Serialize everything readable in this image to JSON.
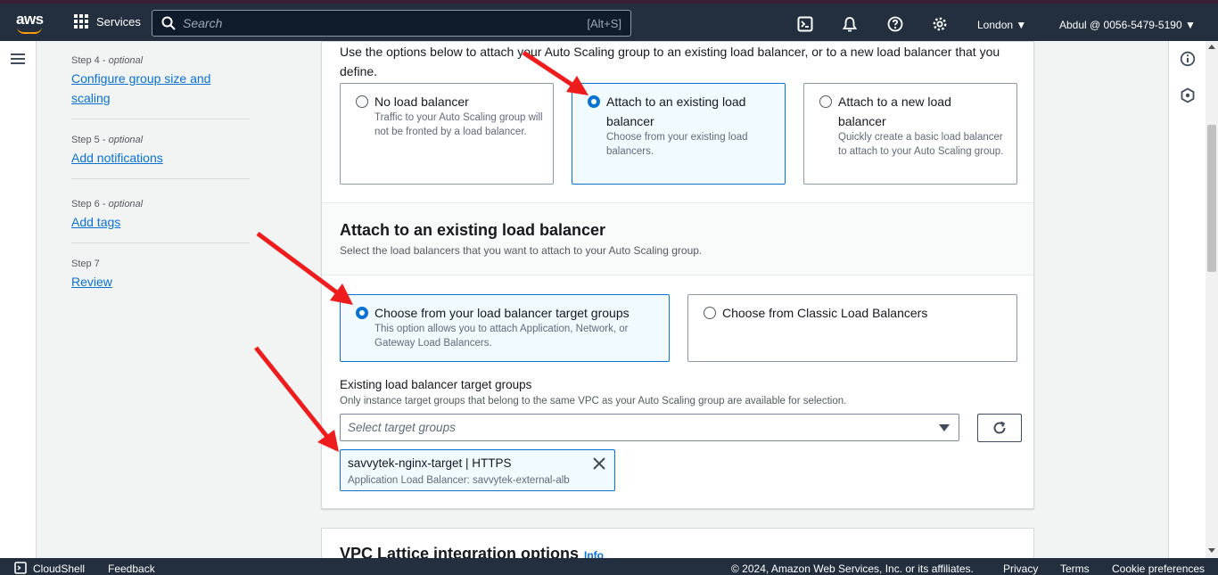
{
  "topbar": {
    "logo": "aws",
    "services_label": "Services",
    "search_placeholder": "Search",
    "search_shortcut": "[Alt+S]",
    "region": "London ▼",
    "account": "Abdul @ 0056-5479-5190 ▼",
    "icons": [
      "cloudshell-icon",
      "bell-icon",
      "help-icon",
      "gear-icon"
    ]
  },
  "steps": [
    {
      "label": "Step 4 - ",
      "optional": "optional",
      "link": "Configure group size and scaling"
    },
    {
      "label": "Step 5 - ",
      "optional": "optional",
      "link": "Add notifications"
    },
    {
      "label": "Step 6 - ",
      "optional": "optional",
      "link": "Add tags"
    },
    {
      "label": "Step 7",
      "optional": "",
      "link": "Review"
    }
  ],
  "load_balancing": {
    "intro": "Use the options below to attach your Auto Scaling group to an existing load balancer, or to a new load balancer that you define.",
    "options": [
      {
        "title": "No load balancer",
        "desc": "Traffic to your Auto Scaling group will not be fronted by a load balancer.",
        "selected": false
      },
      {
        "title": "Attach to an existing load balancer",
        "desc": "Choose from your existing load balancers.",
        "selected": true
      },
      {
        "title": "Attach to a new load balancer",
        "desc": "Quickly create a basic load balancer to attach to your Auto Scaling group.",
        "selected": false
      }
    ]
  },
  "existing_lb": {
    "heading": "Attach to an existing load balancer",
    "desc": "Select the load balancers that you want to attach to your Auto Scaling group.",
    "options": [
      {
        "title": "Choose from your load balancer target groups",
        "desc": "This option allows you to attach Application, Network, or Gateway Load Balancers.",
        "selected": true
      },
      {
        "title": "Choose from Classic Load Balancers",
        "desc": "",
        "selected": false
      }
    ],
    "field_label": "Existing load balancer target groups",
    "field_desc": "Only instance target groups that belong to the same VPC as your Auto Scaling group are available for selection.",
    "select_placeholder": "Select target groups",
    "token": {
      "title": "savvytek-nginx-target | HTTPS",
      "subtitle": "Application Load Balancer: savvytek-external-alb"
    }
  },
  "vpc_lattice": {
    "title": "VPC Lattice integration options",
    "info": "Info"
  },
  "footer": {
    "cloudshell": "CloudShell",
    "feedback": "Feedback",
    "copyright": "© 2024, Amazon Web Services, Inc. or its affiliates.",
    "privacy": "Privacy",
    "terms": "Terms",
    "cookies": "Cookie preferences"
  },
  "colors": {
    "nav_bg": "#232f3e",
    "accent_blue": "#0972d3",
    "selected_bg": "#f1faff",
    "arrow_red": "#ee1c1c"
  }
}
